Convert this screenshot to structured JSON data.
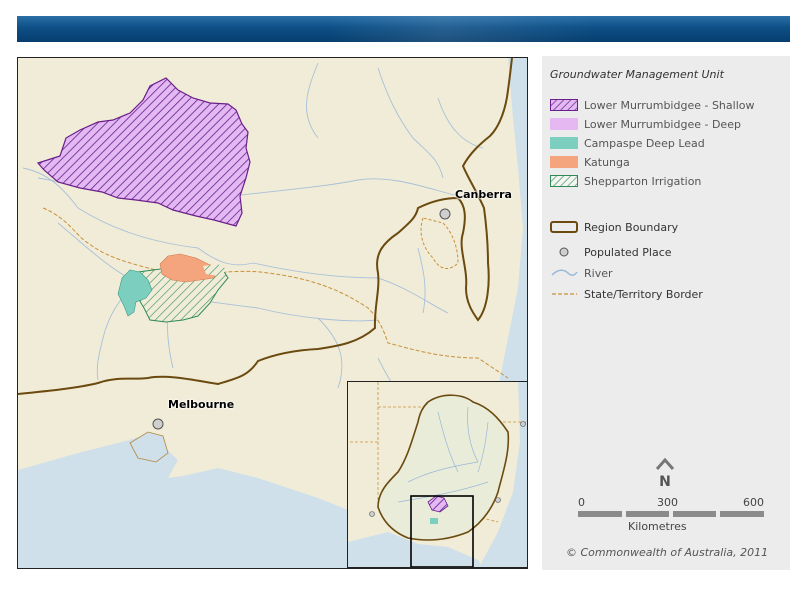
{
  "map": {
    "places": [
      {
        "name": "Canberra"
      },
      {
        "name": "Melbourne"
      }
    ]
  },
  "legend": {
    "title": "Groundwater Management Unit",
    "units": [
      {
        "label": "Lower Murrumbidgee - Shallow",
        "color": "#b36bd9",
        "pattern": "hatch"
      },
      {
        "label": "Lower Murrumbidgee - Deep",
        "color": "#e6b8f2",
        "pattern": "solid"
      },
      {
        "label": "Campaspe Deep Lead",
        "color": "#7ccfbf",
        "pattern": "solid"
      },
      {
        "label": "Katunga",
        "color": "#f4a57d",
        "pattern": "solid"
      },
      {
        "label": "Shepparton Irrigation",
        "color": "#2e8b57",
        "pattern": "hatch"
      }
    ],
    "features": [
      {
        "label": "Region Boundary",
        "color": "#6b4a10",
        "icon": "region-boundary-line"
      },
      {
        "label": "Populated Place",
        "color": "#9a9a9a",
        "icon": "populated-place-dot"
      },
      {
        "label": "River",
        "color": "#9ab8d8",
        "icon": "river-line"
      },
      {
        "label": "State/Territory Border",
        "color": "#c8903a",
        "icon": "state-border-line"
      }
    ]
  },
  "north_arrow": {
    "label": "N",
    "icon": "north-arrow-icon"
  },
  "scale": {
    "ticks": [
      "0",
      "300",
      "600"
    ],
    "units": "Kilometres"
  },
  "copyright": "© Commonwealth of Australia, 2011",
  "colors": {
    "banner": "#0d4f86",
    "land": "#f1ecd7",
    "sea": "#cfe0ea"
  }
}
